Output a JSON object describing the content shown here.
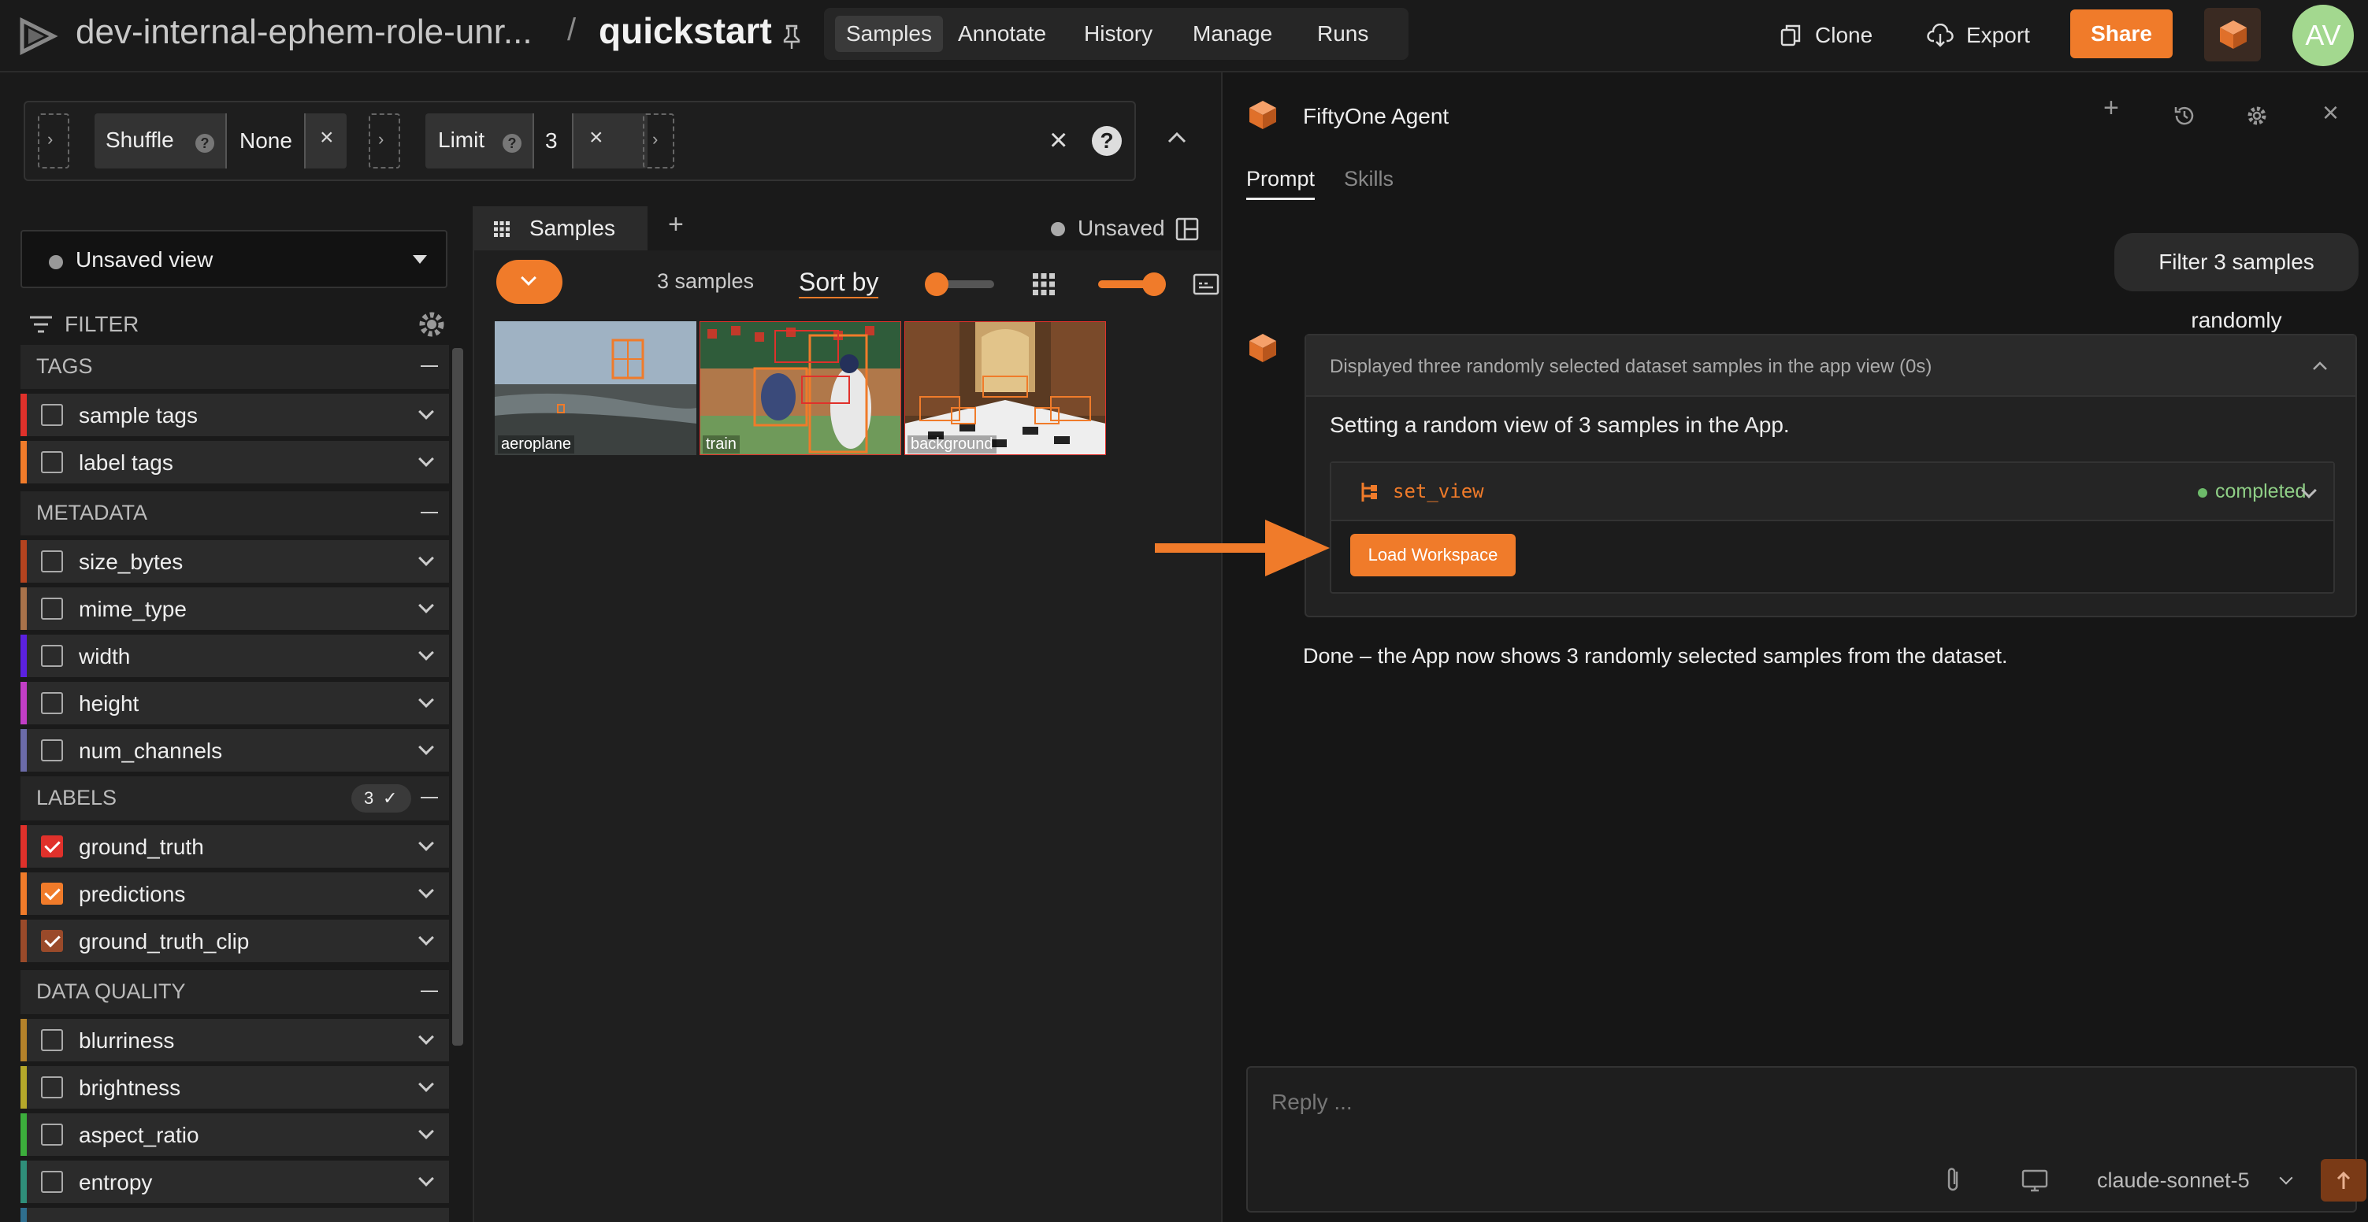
{
  "header": {
    "dataset_name": "dev-internal-ephem-role-unr...",
    "separator": "/",
    "project": "quickstart",
    "nav_tabs": [
      "Samples",
      "Annotate",
      "History",
      "Manage",
      "Runs"
    ],
    "clone_label": "Clone",
    "export_label": "Export",
    "share_label": "Share",
    "avatar_initials": "AV"
  },
  "view_bar": {
    "stages": [
      {
        "label": "Shuffle",
        "value": "None"
      },
      {
        "label": "Limit",
        "value": "3"
      }
    ]
  },
  "sidebar": {
    "view_select": "Unsaved view",
    "filter_label": "FILTER",
    "groups": [
      {
        "title": "TAGS",
        "fields": [
          {
            "label": "sample tags",
            "checked": false,
            "color": "#e0312b"
          },
          {
            "label": "label tags",
            "checked": false,
            "color": "#f07b2a"
          }
        ]
      },
      {
        "title": "METADATA",
        "fields": [
          {
            "label": "size_bytes",
            "checked": false,
            "color": "#b5431f"
          },
          {
            "label": "mime_type",
            "checked": false,
            "color": "#a8724a"
          },
          {
            "label": "width",
            "checked": false,
            "color": "#5b21e0"
          },
          {
            "label": "height",
            "checked": false,
            "color": "#c23ec6"
          },
          {
            "label": "num_channels",
            "checked": false,
            "color": "#6b6ba8"
          }
        ]
      },
      {
        "title": "LABELS",
        "badge": "3",
        "fields": [
          {
            "label": "ground_truth",
            "checked": true,
            "color": "#e0312b"
          },
          {
            "label": "predictions",
            "checked": true,
            "color": "#f07b2a"
          },
          {
            "label": "ground_truth_clip",
            "checked": true,
            "color": "#9a4a2a"
          }
        ]
      },
      {
        "title": "DATA QUALITY",
        "fields": [
          {
            "label": "blurriness",
            "checked": false,
            "color": "#b5822a"
          },
          {
            "label": "brightness",
            "checked": false,
            "color": "#b5a82a"
          },
          {
            "label": "aspect_ratio",
            "checked": false,
            "color": "#3cae3c"
          },
          {
            "label": "entropy",
            "checked": false,
            "color": "#2f8f7a"
          }
        ]
      }
    ]
  },
  "grid": {
    "tab_label": "Samples",
    "unsaved_label": "Unsaved",
    "count_label": "3 samples",
    "sort_label": "Sort by",
    "samples": [
      {
        "label": "aeroplane"
      },
      {
        "label": "train"
      },
      {
        "label": "background"
      }
    ]
  },
  "agent": {
    "title": "FiftyOne Agent",
    "tabs": [
      "Prompt",
      "Skills"
    ],
    "user_message": "Filter 3 samples randomly",
    "tool_header": "Displayed three randomly selected dataset samples in the app view (0s)",
    "tool_subtext": "Setting a random view of 3 samples in the App.",
    "call_name": "set_view",
    "call_status": "completed",
    "load_button": "Load Workspace",
    "done_text": "Done – the App now shows 3 randomly selected samples from the dataset.",
    "reply_placeholder": "Reply ...",
    "model": "claude-sonnet-5"
  },
  "colors": {
    "accent": "#f07b2a",
    "background": "#1a1a1a",
    "success": "#6dbb6a"
  }
}
